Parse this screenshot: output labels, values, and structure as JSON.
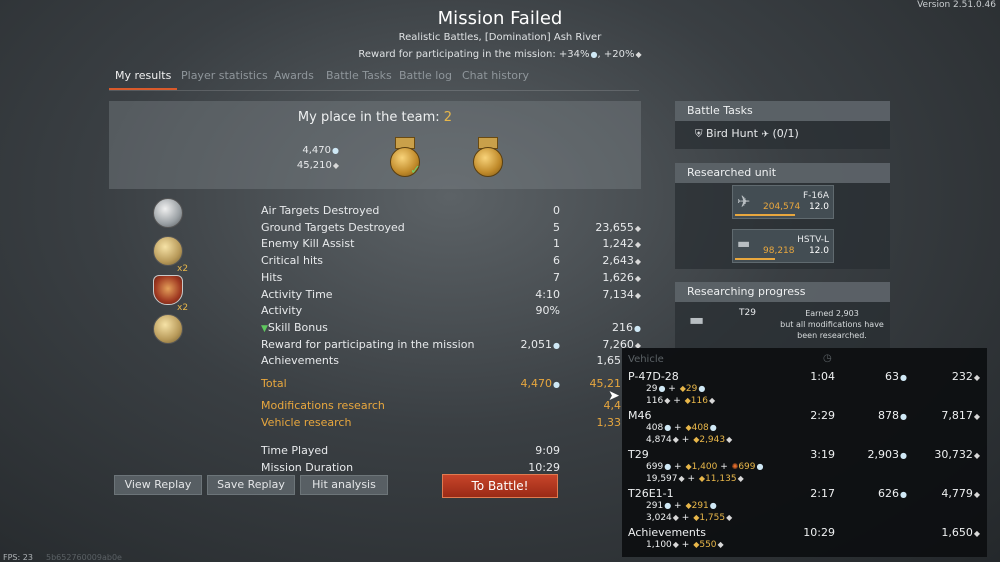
{
  "version": "Version 2.51.0.46",
  "header": {
    "title": "Mission Failed",
    "subtitle": "Realistic Battles, [Domination] Ash River",
    "reward_prefix": "Reward for participating in the mission: ",
    "reward_rp": "+34%",
    "reward_sl": "+20%"
  },
  "tabs": [
    "My results",
    "Player statistics",
    "Awards",
    "Battle Tasks",
    "Battle log",
    "Chat history"
  ],
  "place": {
    "label": "My place in the team:",
    "value": "2",
    "rp": "4,470",
    "sl": "45,210"
  },
  "award_multipliers": [
    "x2",
    "x2"
  ],
  "stats": [
    {
      "name": "Air Targets Destroyed",
      "count": "0",
      "reward": ""
    },
    {
      "name": "Ground Targets Destroyed",
      "count": "5",
      "reward": "23,655"
    },
    {
      "name": "Enemy Kill Assist",
      "count": "1",
      "reward": "1,242"
    },
    {
      "name": "Critical hits",
      "count": "6",
      "reward": "2,643"
    },
    {
      "name": "Hits",
      "count": "7",
      "reward": "1,626"
    },
    {
      "name": "Activity Time",
      "count": "4:10",
      "reward": "7,134"
    },
    {
      "name": "Activity",
      "count": "90%",
      "reward": ""
    },
    {
      "name": "Skill Bonus",
      "count": "",
      "reward": "216"
    },
    {
      "name": "Reward for participating in the mission",
      "count": "2,051",
      "reward": "7,260"
    },
    {
      "name": "Achievements",
      "count": "",
      "reward": "1,65"
    }
  ],
  "total": {
    "name": "Total",
    "count": "4,470",
    "reward": "45,21"
  },
  "research": [
    {
      "name": "Modifications research",
      "value": "4,4"
    },
    {
      "name": "Vehicle research",
      "value": "1,33"
    }
  ],
  "times": [
    {
      "name": "Time Played",
      "value": "9:09"
    },
    {
      "name": "Mission Duration",
      "value": "10:29"
    }
  ],
  "buttons": {
    "view_replay": "View Replay",
    "save_replay": "Save Replay",
    "hit_analysis": "Hit analysis",
    "to_battle": "To Battle!"
  },
  "battle_tasks": {
    "header": "Battle Tasks",
    "task": "Bird Hunt",
    "progress": "(0/1)"
  },
  "researched_unit": {
    "header": "Researched unit",
    "units": [
      {
        "name": "F-16A",
        "rp": "204,574",
        "br": "12.0"
      },
      {
        "name": "HSTV-L",
        "rp": "98,218",
        "br": "12.0"
      }
    ]
  },
  "researching_progress": {
    "header": "Researching progress",
    "vehicle": "T29",
    "text1": "Earned 2,903",
    "text2": "but all modifications have",
    "text3": "been researched."
  },
  "vehicle_table": {
    "header": "Vehicle",
    "rows": [
      {
        "name": "P-47D-28",
        "time": "1:04",
        "rp": "63",
        "sl": "232",
        "b1a": "29",
        "b1b": "29",
        "b2a": "116",
        "b2b": "116"
      },
      {
        "name": "M46",
        "time": "2:29",
        "rp": "878",
        "sl": "7,817",
        "b1a": "408",
        "b1b": "408",
        "b2a": "4,874",
        "b2b": "2,943"
      },
      {
        "name": "T29",
        "time": "3:19",
        "rp": "2,903",
        "sl": "30,732",
        "b1a": "699",
        "b1b": "1,400",
        "b1c": "699",
        "b2a": "19,597",
        "b2b": "11,135"
      },
      {
        "name": "T26E1-1",
        "time": "2:17",
        "rp": "626",
        "sl": "4,779",
        "b1a": "291",
        "b1b": "291",
        "b2a": "3,024",
        "b2b": "1,755"
      },
      {
        "name": "Achievements",
        "time": "10:29",
        "rp": "",
        "sl": "1,650",
        "b2a": "1,100",
        "b2b": "550"
      }
    ]
  },
  "fps": "FPS: 23",
  "build": "5b652760009ab0e",
  "colors": {
    "accent": "#e8a73e",
    "tab_underline": "#d95a2b",
    "battle_button": "#b8391f"
  }
}
